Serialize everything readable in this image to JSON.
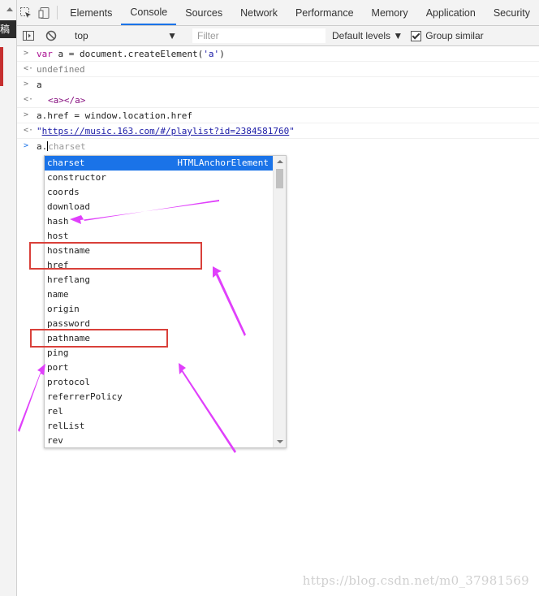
{
  "page_strip": {
    "label": "稿"
  },
  "tabs": [
    {
      "label": "Elements",
      "active": false
    },
    {
      "label": "Console",
      "active": true
    },
    {
      "label": "Sources",
      "active": false
    },
    {
      "label": "Network",
      "active": false
    },
    {
      "label": "Performance",
      "active": false
    },
    {
      "label": "Memory",
      "active": false
    },
    {
      "label": "Application",
      "active": false
    },
    {
      "label": "Security",
      "active": false
    }
  ],
  "console_toolbar": {
    "context": "top",
    "filter_placeholder": "Filter",
    "levels": "Default levels",
    "group_similar": "Group similar",
    "group_similar_checked": true
  },
  "console": {
    "lines": {
      "l1_kw": "var",
      "l1_rest": " a = document.createElement(",
      "l1_str": "'a'",
      "l1_end": ")",
      "r1": "undefined",
      "l2": "a",
      "r2": "<a></a>",
      "l3": "a.href = window.location.href",
      "r3_q1": "\"",
      "r3_url": "https://music.163.com/#/playlist?id=2384581760",
      "r3_q2": "\"",
      "input_typed": "a.",
      "input_ghost": "charset"
    }
  },
  "autocomplete": {
    "selected_type": "HTMLAnchorElement",
    "items": [
      "charset",
      "constructor",
      "coords",
      "download",
      "hash",
      "host",
      "hostname",
      "href",
      "hreflang",
      "name",
      "origin",
      "password",
      "pathname",
      "ping",
      "port",
      "protocol",
      "referrerPolicy",
      "rel",
      "relList",
      "rev"
    ]
  },
  "annotation": {
    "arrow_color": "#e040fb",
    "box_color": "#d9403a"
  },
  "watermark": "https://blog.csdn.net/m0_37981569"
}
